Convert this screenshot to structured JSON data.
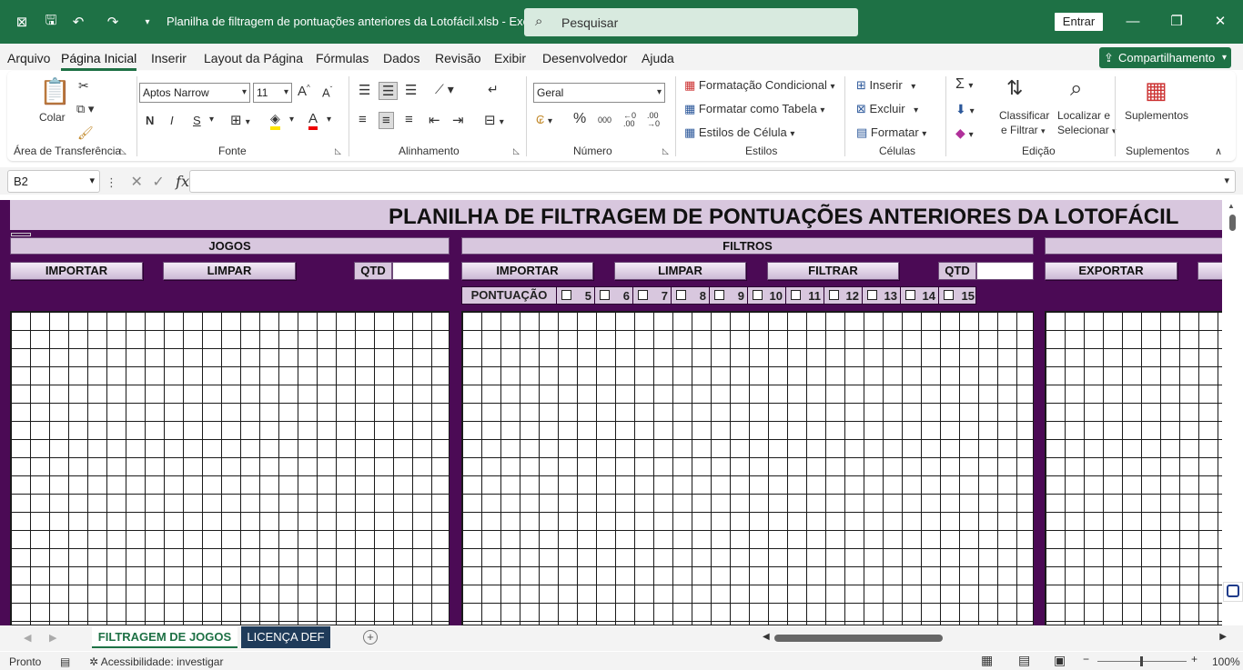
{
  "titlebar": {
    "title": "Planilha de filtragem de pontuações anteriores da Lotofácil.xlsb  -  Excel",
    "search_placeholder": "Pesquisar",
    "signin": "Entrar",
    "icons": [
      "excel-icon",
      "save-icon",
      "undo-icon",
      "redo-icon",
      "customize-icon"
    ]
  },
  "menu": {
    "tabs": [
      "Arquivo",
      "Página Inicial",
      "Inserir",
      "Layout da Página",
      "Fórmulas",
      "Dados",
      "Revisão",
      "Exibir",
      "Desenvolvedor",
      "Ajuda"
    ],
    "active": "Página Inicial",
    "share": "Compartilhamento"
  },
  "ribbon": {
    "clipboard": {
      "label": "Área de Transferência",
      "paste": "Colar"
    },
    "font": {
      "label": "Fonte",
      "name": "Aptos Narrow",
      "size": "11",
      "bold": "N",
      "italic": "I",
      "underline": "S"
    },
    "alignment": {
      "label": "Alinhamento"
    },
    "number": {
      "label": "Número",
      "format": "Geral"
    },
    "styles": {
      "label": "Estilos",
      "conditional": "Formatação Condicional",
      "table": "Formatar como Tabela",
      "cell_styles": "Estilos de Célula"
    },
    "cells": {
      "label": "Células",
      "insert": "Inserir",
      "delete": "Excluir",
      "format": "Formatar"
    },
    "editing": {
      "label": "Edição",
      "sort1": "Classificar",
      "sort2": "e Filtrar",
      "find1": "Localizar e",
      "find2": "Selecionar"
    },
    "addins": {
      "label": "Suplementos",
      "button": "Suplementos"
    }
  },
  "formula_bar": {
    "name_box": "B2",
    "formula": ""
  },
  "sheet": {
    "title": "PLANILHA DE FILTRAGEM DE PONTUAÇÕES ANTERIORES DA LOTOFÁCIL",
    "jogos": "JOGOS",
    "filtros": "FILTROS",
    "buttons": {
      "importar1": "IMPORTAR",
      "limpar1": "LIMPAR",
      "importar2": "IMPORTAR",
      "limpar2": "LIMPAR",
      "filtrar": "FILTRAR",
      "exportar": "EXPORTAR"
    },
    "qtd": "QTD",
    "pontuacao": "PONTUAÇÃO",
    "scores": [
      "5",
      "6",
      "7",
      "8",
      "9",
      "10",
      "11",
      "12",
      "13",
      "14",
      "15"
    ],
    "colors": {
      "background": "#4b0a55",
      "header": "#d8c7de"
    }
  },
  "sheet_tabs": {
    "active": "FILTRAGEM DE JOGOS",
    "other": "LICENÇA DEF"
  },
  "status": {
    "ready": "Pronto",
    "accessibility": "Acessibilidade: investigar",
    "zoom": "100%"
  }
}
